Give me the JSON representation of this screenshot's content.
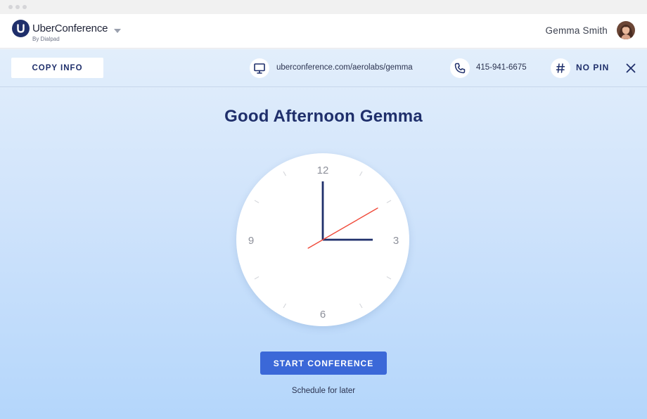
{
  "brand": {
    "name": "UberConference",
    "byline": "By Dialpad",
    "logo_letter": "U",
    "color": "#1f2f6b"
  },
  "user": {
    "name": "Gemma Smith"
  },
  "infobar": {
    "copy_label": "COPY INFO",
    "url": "uberconference.com/aerolabs/gemma",
    "phone": "415-941-6675",
    "pin": "NO PIN",
    "icons": [
      "monitor-icon",
      "phone-icon",
      "hash-icon",
      "close-icon"
    ]
  },
  "greeting": "Good Afternoon Gemma",
  "clock": {
    "numerals": {
      "top": "12",
      "right": "3",
      "bottom": "6",
      "left": "9"
    },
    "time_shown": {
      "hour": 3,
      "minute": 0,
      "second": 10
    },
    "hand_color": "#1f2f6b",
    "second_hand_color": "#f04a3a"
  },
  "actions": {
    "start_label": "START CONFERENCE",
    "schedule_label": "Schedule for later",
    "accent": "#3b68d8"
  }
}
